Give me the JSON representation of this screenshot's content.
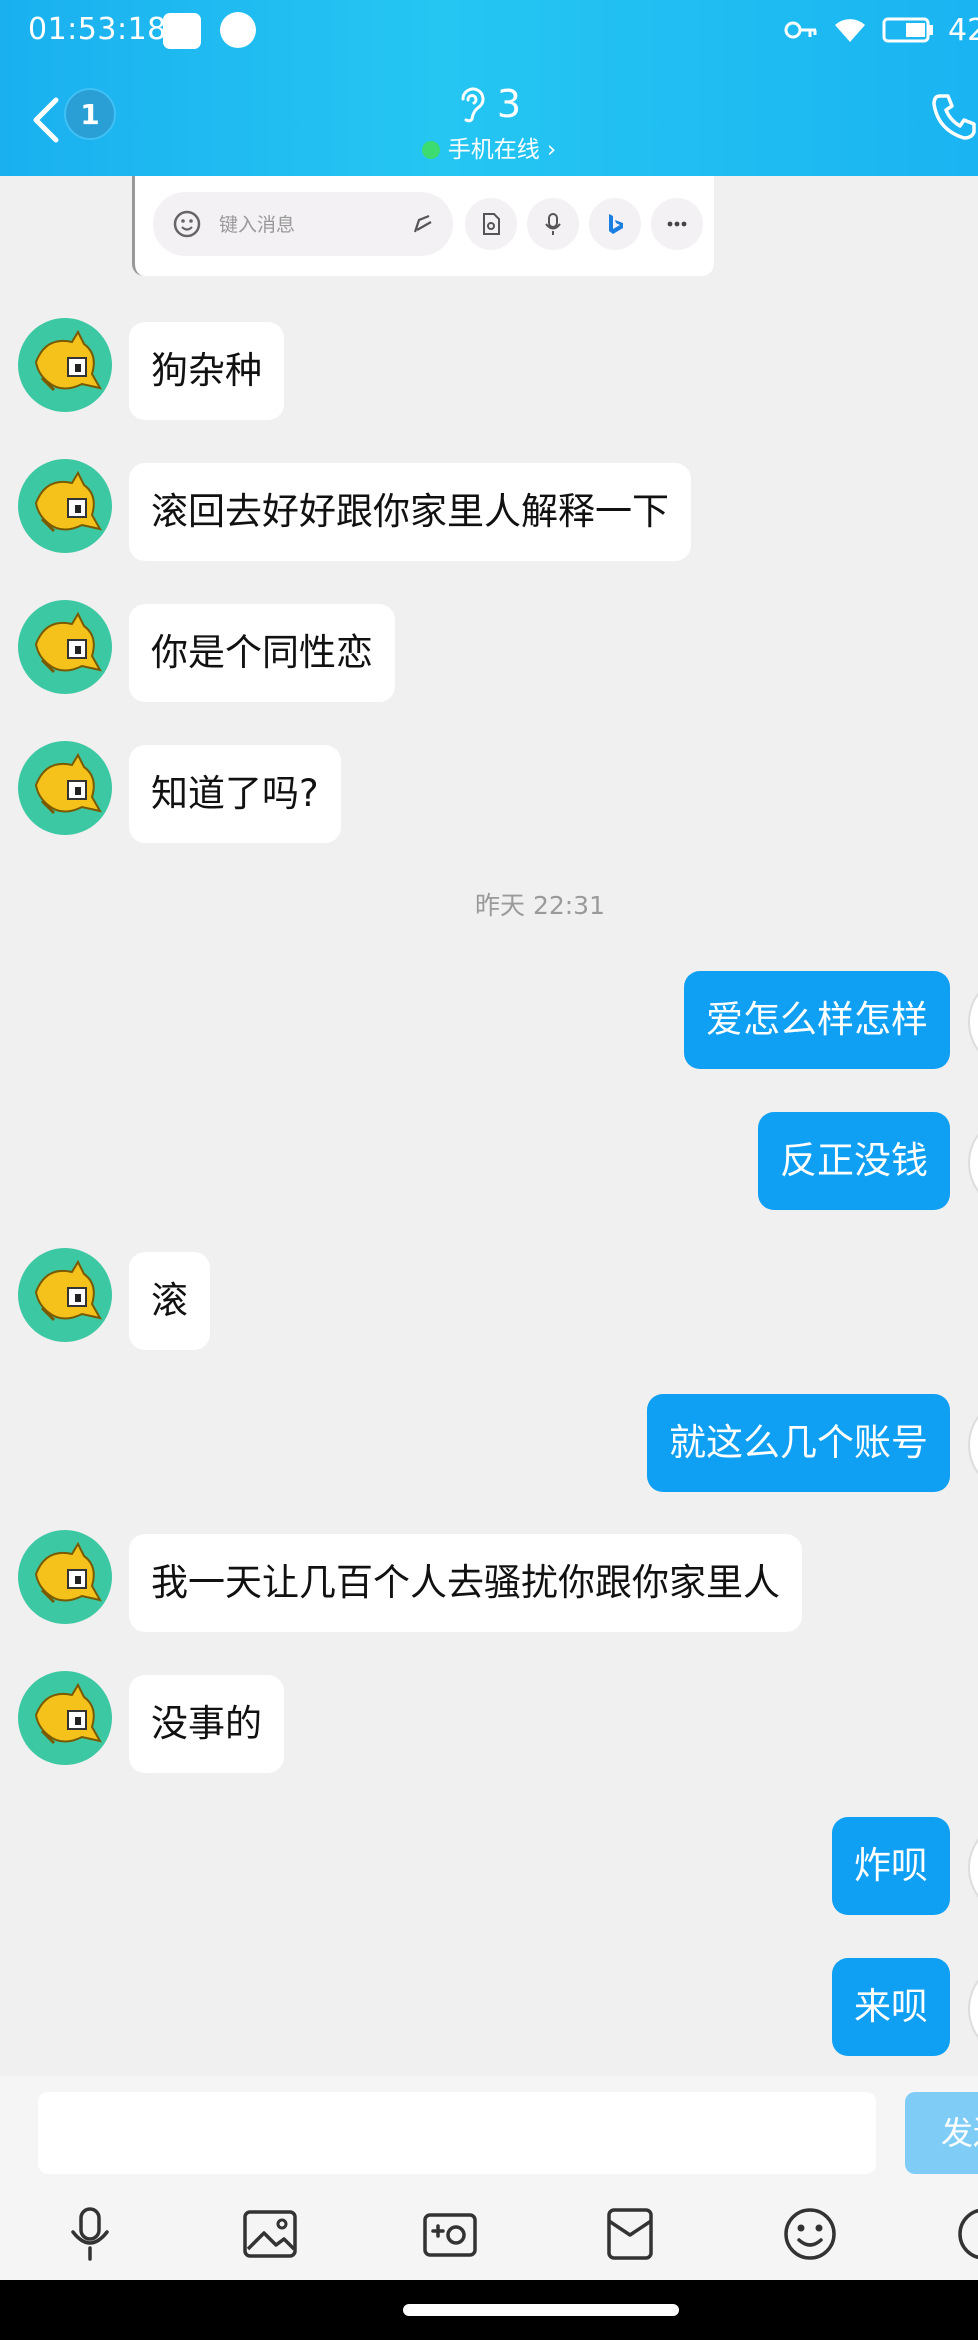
{
  "status_bar": {
    "time": "01:53:18",
    "battery": "42"
  },
  "header": {
    "unread_count": "1",
    "title": "3",
    "subtitle": "手机在线",
    "subtitle_arrow": "›"
  },
  "shared_snippet": {
    "placeholder": "键入消息"
  },
  "messages": [
    {
      "side": "in",
      "text": "狗杂种"
    },
    {
      "side": "in",
      "text": "滚回去好好跟你家里人解释一下"
    },
    {
      "side": "in",
      "text": "你是个同性恋"
    },
    {
      "side": "in",
      "text": "知道了吗?"
    },
    {
      "type": "timestamp",
      "text": "昨天 22:31"
    },
    {
      "side": "out",
      "text": "爱怎么样怎样"
    },
    {
      "side": "out",
      "text": "反正没钱"
    },
    {
      "side": "in",
      "text": "滚"
    },
    {
      "side": "out",
      "text": "就这么几个账号"
    },
    {
      "side": "in",
      "text": "我一天让几百个人去骚扰你跟你家里人"
    },
    {
      "side": "in",
      "text": "没事的"
    },
    {
      "side": "out",
      "text": "炸呗"
    },
    {
      "side": "out",
      "text": "来呗"
    }
  ],
  "composer": {
    "value": "",
    "send_label": "发送"
  },
  "toolbar_icons": [
    "mic-icon",
    "image-icon",
    "camera-icon",
    "red-envelope-icon",
    "emoji-icon",
    "more-icon"
  ],
  "colors": {
    "header": "#1ab0f0",
    "outgoing_bubble": "#0fa0f4",
    "online_dot": "#3ddc70",
    "avatar_bg": "#3cc8a2"
  }
}
